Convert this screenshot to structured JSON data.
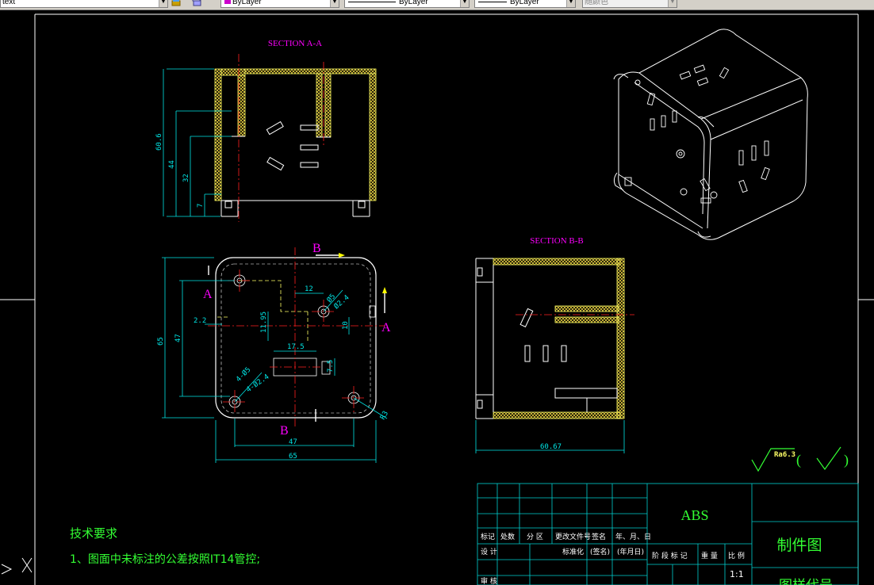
{
  "toolbar": {
    "text_style": "text",
    "layer_color": "ByLayer",
    "linetype": "ByLayer",
    "lineweight": "ByLayer",
    "plot_style": "随颜色"
  },
  "colors": {
    "background": "#000000",
    "geometry": "#ffffff",
    "dimension": "#00e5e5",
    "hatch": "#ffff66",
    "centerline": "#ff2020",
    "section_label": "#ff00ff",
    "tech_text": "#33ff33",
    "titleblock": "#00d0d0",
    "material": "#33ff33"
  },
  "drawing": {
    "section_aa_title": "SECTION A-A",
    "section_bb_title": "SECTION B-B",
    "cut_label_a": "A",
    "cut_label_b": "B",
    "dims_aa": [
      "60.6",
      "44",
      "32",
      "7"
    ],
    "dims_plan": [
      "65",
      "47",
      "2.2",
      "12",
      "11.95",
      "17.5",
      "7.5",
      "10",
      "47",
      "65",
      "R3",
      "Ø5",
      "Ø2.4",
      "4-Ø5",
      "4-Ø2.4"
    ],
    "dims_bb": [
      "60.67"
    ],
    "roughness": "Ra6.3",
    "roughness_paren_open": "(",
    "roughness_paren_close": ")"
  },
  "notes": {
    "title": "技术要求",
    "item1": "1、图面中未标注的公差按照IT14管控;"
  },
  "titleblock": {
    "col_headers": [
      "标记",
      "处数",
      "分 区",
      "更改文件号",
      "签名",
      "年、月、日"
    ],
    "row2": [
      "设 计",
      "标准化",
      "(签名)",
      "(年月日)"
    ],
    "row3": [
      "审 核"
    ],
    "stage_headers": [
      "阶 段 标 记",
      "重 量",
      "比 例"
    ],
    "scale": "1:1",
    "material": "ABS",
    "drawing_type": "制件图",
    "part_name_partial": "图样代号"
  }
}
